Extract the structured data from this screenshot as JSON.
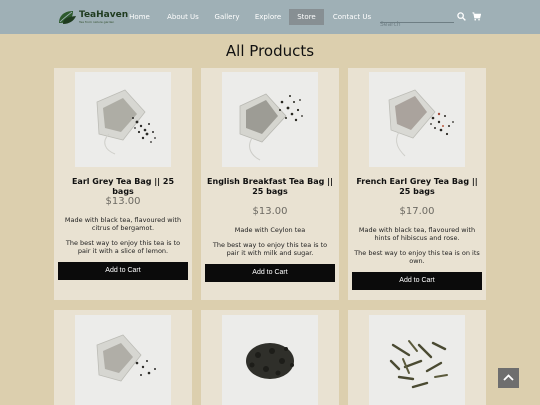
{
  "brand": {
    "name": "TeaHaven",
    "tagline": "Tea from nature garden"
  },
  "nav": [
    {
      "label": "Home"
    },
    {
      "label": "About Us"
    },
    {
      "label": "Gallery"
    },
    {
      "label": "Explore"
    },
    {
      "label": "Store"
    },
    {
      "label": "Contact Us"
    }
  ],
  "search": {
    "placeholder": "Search"
  },
  "page": {
    "title": "All Products"
  },
  "products": [
    {
      "name": "Earl Grey Tea Bag || 25 bags",
      "price": "$13.00",
      "desc1": "Made with black tea, flavoured with citrus of bergamot.",
      "desc2": "The best way to enjoy this tea is to pair it with a slice of lemon.",
      "button": "Add to Cart"
    },
    {
      "name": "English Breakfast Tea Bag || 25 bags",
      "price": "$13.00",
      "desc1": "Made with Ceylon tea",
      "desc2": "The best way to enjoy this tea is to pair it with milk and sugar.",
      "button": "Add to Cart"
    },
    {
      "name": "French Earl Grey Tea Bag || 25 bags",
      "price": "$17.00",
      "desc1": "Made with black tea, flavoured with hints of hibiscus and rose.",
      "desc2": "The best way to enjoy this tea is on its own.",
      "button": "Add to Cart"
    }
  ],
  "colors": {
    "header": "#9fb0b6",
    "background": "#dccfae",
    "card": "#e9e2d2",
    "button": "#0b0b0b",
    "nav_active": "#878f93"
  },
  "icons": {
    "search": "search-icon",
    "cart": "cart-icon",
    "scroll_top": "chevron-up-icon"
  }
}
